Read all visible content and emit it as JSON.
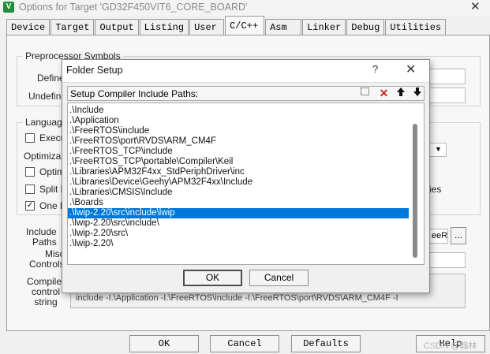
{
  "window": {
    "title": "Options for Target 'GD32F450VIT6_CORE_BOARD'",
    "app_icon": "V",
    "close": "✕"
  },
  "tabs": [
    "Device",
    "Target",
    "Output",
    "Listing",
    "User",
    "C/C++",
    "Asm",
    "Linker",
    "Debug",
    "Utilities"
  ],
  "active_tab": "C/C++",
  "background": {
    "preprocessor_group": "Preprocessor Symbols",
    "define_label": "Define:",
    "undefine_label": "Undefine:",
    "language_group": "Language",
    "execu_label": "Execu",
    "optimization_label": "Optimizatio",
    "optimi_label": "Optimi",
    "split_label": "Split L",
    "one_label": "One E",
    "ies_text": "ies",
    "include_paths_label": "Include\nPaths",
    "include_paths_tail": "eeR",
    "browse_btn": "...",
    "misc_controls_label": "Misc\nControls",
    "compiler_string_label": "Compiler\ncontrol\nstring",
    "compiler_string_value": "include -I.\\Application -I.\\FreeRTOS\\include -I.\\FreeRTOS\\port\\RVDS\\ARM_CM4F -I"
  },
  "bottom_buttons": {
    "ok": "OK",
    "cancel": "Cancel",
    "defaults": "Defaults",
    "help": "Help"
  },
  "watermark": "CSDN @翰林",
  "dialog": {
    "title": "Folder Setup",
    "help": "?",
    "close": "✕",
    "header_label": "Setup Compiler Include Paths:",
    "toolbar": {
      "new": "⬚",
      "delete": "✕",
      "up": "🡅",
      "down": "🡇"
    },
    "paths": [
      ".\\Include",
      ".\\Application",
      ".\\FreeRTOS\\include",
      ".\\FreeRTOS\\port\\RVDS\\ARM_CM4F",
      ".\\FreeRTOS_TCP\\include",
      ".\\FreeRTOS_TCP\\portable\\Compiler\\Keil",
      ".\\Libraries\\APM32F4xx_StdPeriphDriver\\inc",
      ".\\Libraries\\Device\\Geehy\\APM32F4xx\\Include",
      ".\\Libraries\\CMSIS\\Include",
      ".\\Boards",
      ".\\lwip-2.20\\src\\include\\lwip",
      ".\\lwip-2.20\\src\\include\\",
      ".\\lwip-2.20\\src\\",
      ".\\lwip-2.20\\"
    ],
    "selected_index": 10,
    "ok": "OK",
    "cancel": "Cancel"
  },
  "colors": {
    "selection": "#0078d7",
    "app_icon": "#1f8f3a"
  }
}
